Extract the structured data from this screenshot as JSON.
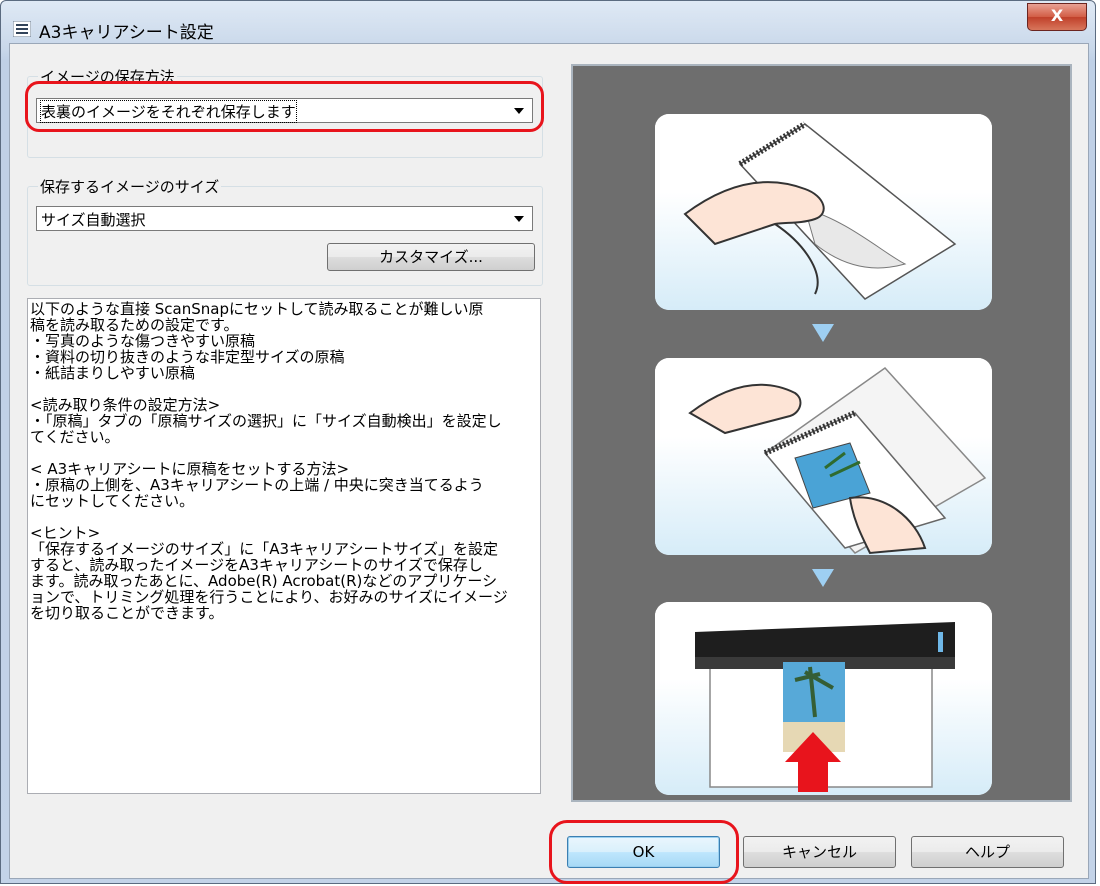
{
  "window": {
    "title": "A3キャリアシート設定",
    "close_label": "X"
  },
  "save_method": {
    "legend": "イメージの保存方法",
    "selected": "表裏のイメージをそれぞれ保存します"
  },
  "image_size": {
    "legend": "保存するイメージのサイズ",
    "selected": "サイズ自動選択",
    "customize_label": "カスタマイズ..."
  },
  "description": "以下のような直接 ScanSnapにセットして読み取ることが難しい原\n稿を読み取るための設定です。\n・写真のような傷つきやすい原稿\n・資料の切り抜きのような非定型サイズの原稿\n・紙詰まりしやすい原稿\n\n<読み取り条件の設定方法>\n・「原稿」タブの「原稿サイズの選択」に「サイズ自動検出」を設定し\nてください。\n\n< A3キャリアシートに原稿をセットする方法>\n・原稿の上側を、A3キャリアシートの上端 / 中央に突き当てるよう\nにセットしてください。\n\n<ヒント>\n「保存するイメージのサイズ」に「A3キャリアシートサイズ」を設定\nすると、読み取ったイメージをA3キャリアシートのサイズで保存し\nます。読み取ったあとに、Adobe(R) Acrobat(R)などのアプリケーシ\nョンで、トリミング処理を行うことにより、お好みのサイズにイメージ\nを切り取ることができます。",
  "buttons": {
    "ok": "OK",
    "cancel": "キャンセル",
    "help": "ヘルプ"
  },
  "colors": {
    "highlight": "#e8141c",
    "preview_bg": "#6e6e6e",
    "step_arrow": "#9ecff2"
  }
}
